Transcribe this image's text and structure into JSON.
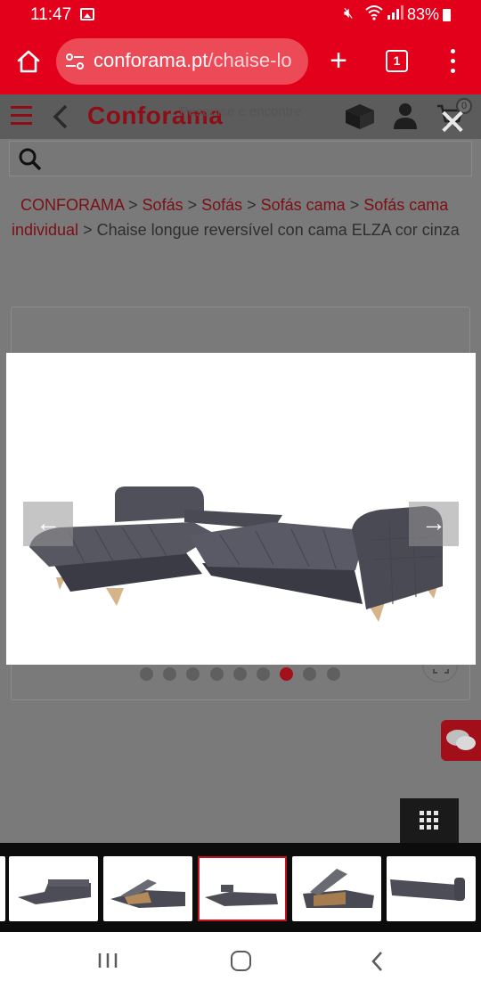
{
  "status_bar": {
    "time": "11:47",
    "battery": "83%",
    "icons": [
      "gallery-icon",
      "mute-icon",
      "wifi-icon",
      "signal-icon",
      "battery-icon"
    ]
  },
  "browser": {
    "url_domain": "conforama.pt",
    "url_path": "/chaise-lo",
    "tab_count": "1",
    "accent": "#e2001a"
  },
  "site": {
    "logo": "Conforama",
    "cart_count": "0",
    "search_placeholder": "Pesquise e encontre"
  },
  "breadcrumb": {
    "items": [
      "CONFORAMA",
      "Sofás",
      "Sofás",
      "Sofás cama",
      "Sofás cama individual"
    ],
    "separator": " > ",
    "current": "Chaise longue reversível con cama ELZA cor cinza"
  },
  "gallery": {
    "arrow_prev": "←",
    "arrow_next": "→",
    "dot_count": 9,
    "active_dot": 7,
    "thumbnails": [
      {
        "label": "chaise-longue-front-view"
      },
      {
        "label": "chaise-longue-storage-open"
      },
      {
        "label": "chaise-longue-bed-view",
        "active": true
      },
      {
        "label": "chaise-storage-detail"
      },
      {
        "label": "sofa-side-view"
      }
    ]
  }
}
